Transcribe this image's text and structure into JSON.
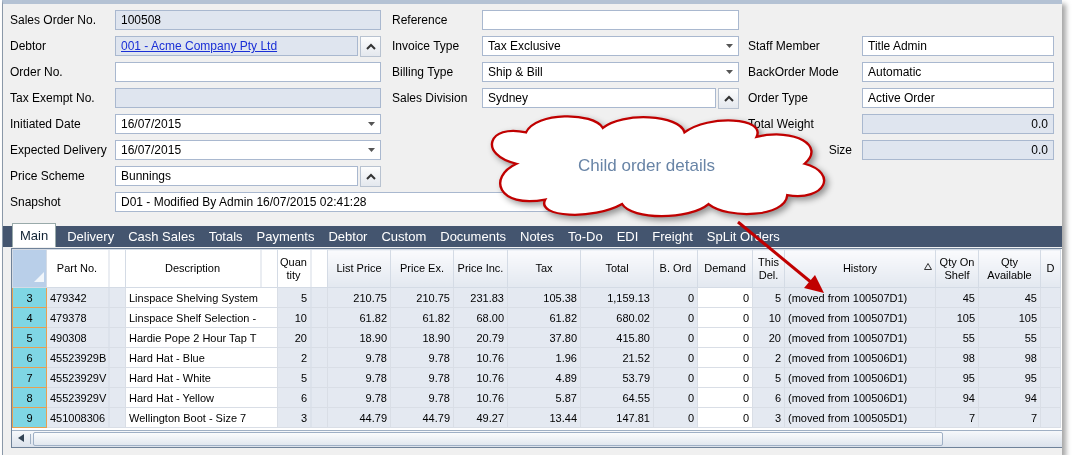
{
  "form": {
    "left": [
      {
        "label": "Sales Order No.",
        "value": "100508",
        "kind": "text",
        "readonly": true
      },
      {
        "label": "Debtor",
        "value": "001 - Acme Company Pty Ltd",
        "kind": "link-lookup",
        "readonly": true
      },
      {
        "label": "Order No.",
        "kind": "text",
        "readonly": false
      },
      {
        "label": "Tax Exempt No.",
        "kind": "text",
        "readonly": true
      },
      {
        "label": "Initiated Date",
        "value": "16/07/2015",
        "kind": "dropdown",
        "readonly": false
      },
      {
        "label": "Expected Delivery",
        "value": "16/07/2015",
        "kind": "dropdown",
        "readonly": false
      },
      {
        "label": "Price Scheme",
        "value": "Bunnings",
        "kind": "lookup",
        "readonly": false
      },
      {
        "label": "Snapshot",
        "value": "D01 - Modified By Admin 16/07/2015 02:41:28",
        "kind": "wide",
        "readonly": false
      }
    ],
    "middle": [
      {
        "label": "Reference",
        "kind": "text",
        "readonly": false
      },
      {
        "label": "Invoice Type",
        "value": "Tax Exclusive",
        "kind": "dropdown",
        "readonly": false
      },
      {
        "label": "Billing Type",
        "value": "Ship & Bill",
        "kind": "dropdown",
        "readonly": false
      },
      {
        "label": "Sales Division",
        "value": "Sydney",
        "kind": "lookup",
        "readonly": false
      }
    ],
    "right": [
      {
        "label": "Staff Member",
        "value": "Title Admin",
        "kind": "text",
        "readonly": false,
        "label_clipped": false
      },
      {
        "label": "BackOrder Mode",
        "value": "Automatic",
        "kind": "text",
        "readonly": false,
        "label_clipped": false
      },
      {
        "label": "Order Type",
        "value": "Active Order",
        "kind": "text",
        "readonly": false,
        "label_clipped": false
      },
      {
        "label": "Total Weight",
        "value": "0.0",
        "kind": "number",
        "readonly": true,
        "label_clipped": false
      },
      {
        "label": "Size",
        "value": "0.0",
        "kind": "number",
        "readonly": true,
        "label_clipped": true
      }
    ]
  },
  "tabs": [
    {
      "label": "Main",
      "selected": true
    },
    {
      "label": "Delivery",
      "selected": false
    },
    {
      "label": "Cash Sales",
      "selected": false
    },
    {
      "label": "Totals",
      "selected": false
    },
    {
      "label": "Payments",
      "selected": false
    },
    {
      "label": "Debtor",
      "selected": false
    },
    {
      "label": "Custom",
      "selected": false
    },
    {
      "label": "Documents",
      "selected": false
    },
    {
      "label": "Notes",
      "selected": false
    },
    {
      "label": "To-Do",
      "selected": false
    },
    {
      "label": "EDI",
      "selected": false
    },
    {
      "label": "Freight",
      "selected": false
    },
    {
      "label": "SpLit Orders",
      "selected": false
    }
  ],
  "table": {
    "columns": [
      {
        "label": "Part No.",
        "kind": "text",
        "editable": false,
        "spacer_after": true,
        "sorted_ascending": false
      },
      {
        "label": "Description",
        "kind": "text",
        "editable": true,
        "spacer_after": true,
        "sorted_ascending": false
      },
      {
        "label": "Quantity",
        "kind": "number",
        "editable": false,
        "spacer_after": true,
        "sorted_ascending": false
      },
      {
        "label": "List Price",
        "kind": "number",
        "editable": false,
        "spacer_after": false,
        "sorted_ascending": false
      },
      {
        "label": "Price Ex.",
        "kind": "number",
        "editable": false,
        "spacer_after": false,
        "sorted_ascending": false
      },
      {
        "label": "Price Inc.",
        "kind": "number",
        "editable": false,
        "spacer_after": false,
        "sorted_ascending": false
      },
      {
        "label": "Tax",
        "kind": "number",
        "editable": false,
        "spacer_after": false,
        "sorted_ascending": false
      },
      {
        "label": "Total",
        "kind": "number",
        "editable": false,
        "spacer_after": false,
        "sorted_ascending": false
      },
      {
        "label": "B. Ord",
        "kind": "number",
        "editable": false,
        "spacer_after": false,
        "sorted_ascending": false
      },
      {
        "label": "Demand",
        "kind": "number",
        "editable": true,
        "spacer_after": false,
        "sorted_ascending": false
      },
      {
        "label": "This Del.",
        "kind": "number",
        "editable": false,
        "spacer_after": false,
        "sorted_ascending": false
      },
      {
        "label": "History",
        "kind": "text",
        "editable": false,
        "spacer_after": false,
        "sorted_ascending": true
      },
      {
        "label": "Qty On Shelf",
        "kind": "number",
        "editable": false,
        "spacer_after": false,
        "sorted_ascending": false
      },
      {
        "label": "Qty Available",
        "kind": "number",
        "editable": false,
        "spacer_after": false,
        "sorted_ascending": false
      },
      {
        "label": "D",
        "kind": "text",
        "editable": false,
        "spacer_after": false,
        "sorted_ascending": false
      }
    ],
    "rows": [
      {
        "row_number": "3",
        "cells": [
          "479342",
          "Linspace Shelving System",
          "5",
          "210.75",
          "210.75",
          "231.83",
          "105.38",
          "1,159.13",
          "0",
          "0",
          "5",
          "(moved from 100507D1)",
          "45",
          "45"
        ]
      },
      {
        "row_number": "4",
        "cells": [
          "479378",
          "Linspace Shelf Selection -",
          "10",
          "61.82",
          "61.82",
          "68.00",
          "61.82",
          "680.02",
          "0",
          "0",
          "10",
          "(moved from 100507D1)",
          "105",
          "105"
        ]
      },
      {
        "row_number": "5",
        "cells": [
          "490308",
          "Hardie Pope 2 Hour Tap T",
          "20",
          "18.90",
          "18.90",
          "20.79",
          "37.80",
          "415.80",
          "0",
          "0",
          "20",
          "(moved from 100507D1)",
          "55",
          "55"
        ]
      },
      {
        "row_number": "6",
        "cells": [
          "45523929B",
          "Hard Hat - Blue",
          "2",
          "9.78",
          "9.78",
          "10.76",
          "1.96",
          "21.52",
          "0",
          "0",
          "2",
          "(moved from 100506D1)",
          "98",
          "98"
        ]
      },
      {
        "row_number": "7",
        "cells": [
          "45523929V",
          "Hard Hat - White",
          "5",
          "9.78",
          "9.78",
          "10.76",
          "4.89",
          "53.79",
          "0",
          "0",
          "5",
          "(moved from 100506D1)",
          "95",
          "95"
        ]
      },
      {
        "row_number": "8",
        "cells": [
          "45523929V",
          "Hard Hat - Yellow",
          "6",
          "9.78",
          "9.78",
          "10.76",
          "5.87",
          "64.55",
          "0",
          "0",
          "6",
          "(moved from 100506D1)",
          "94",
          "94"
        ]
      },
      {
        "row_number": "9",
        "cells": [
          "451008306",
          "Wellington Boot - Size 7",
          "3",
          "44.79",
          "44.79",
          "49.27",
          "13.44",
          "147.81",
          "0",
          "0",
          "3",
          "(moved from 100505D1)",
          "7",
          "7"
        ]
      }
    ]
  },
  "callout": {
    "text": "Child order details"
  }
}
